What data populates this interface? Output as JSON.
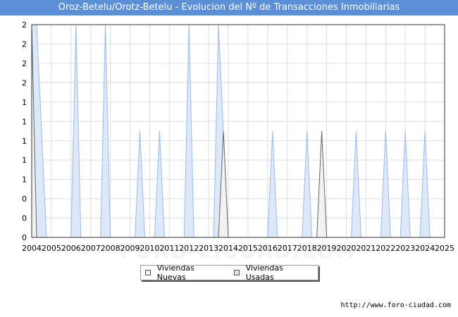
{
  "title": "Oroz-Betelu/Orotz-Betelu - Evolucion del Nº de Transacciones Inmobiliarias",
  "source": "http://www.foro-ciudad.com",
  "watermark": "FORO-CIUDAD.COM",
  "colors": {
    "title_bg": "#5b8fd6",
    "nuevas_fill": "#f2f2f2",
    "nuevas_line": "#666666",
    "usadas_fill": "#dde9fa",
    "usadas_line": "#9bbbea",
    "grid": "#dddddd"
  },
  "chart_data": {
    "type": "area",
    "title": "Oroz-Betelu/Orotz-Betelu - Evolucion del Nº de Transacciones Inmobiliarias",
    "xlabel": "",
    "ylabel": "",
    "xlim": [
      2004,
      2025
    ],
    "ylim": [
      0,
      2
    ],
    "grid": true,
    "legend_position": "bottom",
    "x_tick_labels": [
      "2004",
      "2005",
      "2006",
      "2007",
      "2008",
      "2009",
      "2010",
      "2011",
      "2012",
      "2013",
      "2014",
      "2015",
      "2016",
      "2017",
      "2018",
      "2019",
      "2020",
      "2021",
      "2022",
      "2023",
      "2024",
      "2025"
    ],
    "y_tick_labels": [
      "0",
      "0",
      "0",
      "1",
      "1",
      "1",
      "1",
      "1",
      "2",
      "2",
      "2",
      "2"
    ],
    "series": [
      {
        "name": "Viviendas Nuevas",
        "points": [
          [
            2004.0,
            2
          ],
          [
            2004.25,
            0
          ],
          [
            2013.5,
            0
          ],
          [
            2013.75,
            1
          ],
          [
            2014.0,
            0
          ],
          [
            2018.5,
            0
          ],
          [
            2018.75,
            1
          ],
          [
            2019.0,
            0
          ],
          [
            2025.0,
            0
          ]
        ]
      },
      {
        "name": "Viviendas Usadas",
        "points": [
          [
            2004.0,
            2
          ],
          [
            2004.25,
            2
          ],
          [
            2004.75,
            0
          ],
          [
            2006.0,
            0
          ],
          [
            2006.25,
            2
          ],
          [
            2006.5,
            0
          ],
          [
            2007.5,
            0
          ],
          [
            2007.75,
            2
          ],
          [
            2008.0,
            0
          ],
          [
            2009.25,
            0
          ],
          [
            2009.5,
            1
          ],
          [
            2009.75,
            0
          ],
          [
            2010.25,
            0
          ],
          [
            2010.5,
            1
          ],
          [
            2010.75,
            0
          ],
          [
            2011.75,
            0
          ],
          [
            2012.0,
            2
          ],
          [
            2012.25,
            0
          ],
          [
            2013.25,
            0
          ],
          [
            2013.5,
            2
          ],
          [
            2014.0,
            0
          ],
          [
            2016.0,
            0
          ],
          [
            2016.25,
            1
          ],
          [
            2016.5,
            0
          ],
          [
            2017.75,
            0
          ],
          [
            2018.0,
            1
          ],
          [
            2018.25,
            0
          ],
          [
            2020.25,
            0
          ],
          [
            2020.5,
            1
          ],
          [
            2020.75,
            0
          ],
          [
            2021.75,
            0
          ],
          [
            2022.0,
            1
          ],
          [
            2022.25,
            0
          ],
          [
            2022.75,
            0
          ],
          [
            2023.0,
            1
          ],
          [
            2023.25,
            0
          ],
          [
            2023.75,
            0
          ],
          [
            2024.0,
            1
          ],
          [
            2024.25,
            0
          ],
          [
            2025.0,
            0
          ]
        ]
      }
    ]
  }
}
